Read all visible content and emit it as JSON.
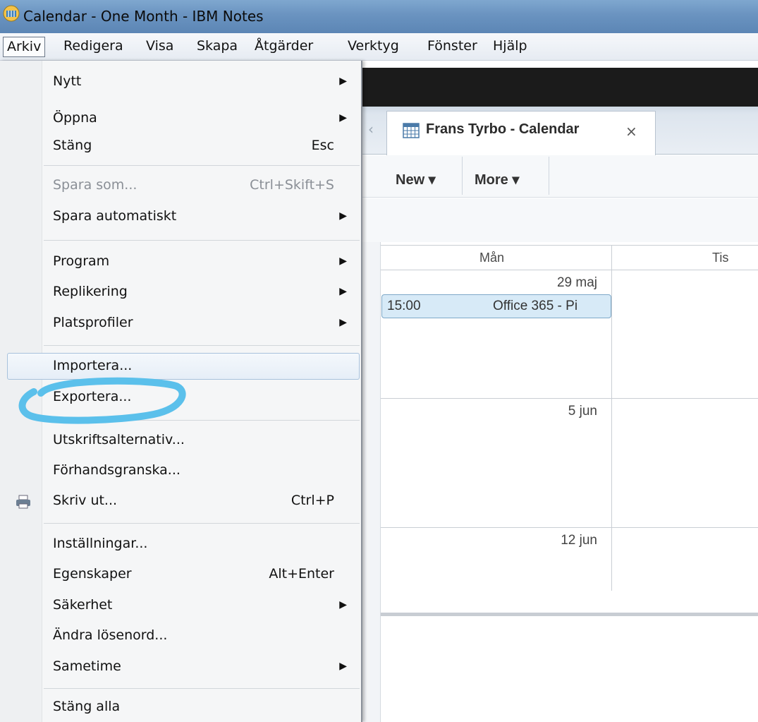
{
  "window": {
    "title": "Calendar - One Month - IBM Notes"
  },
  "menubar": {
    "items": [
      {
        "label": "Arkiv",
        "active": true
      },
      {
        "label": "Redigera"
      },
      {
        "label": "Visa"
      },
      {
        "label": "Skapa"
      },
      {
        "label": "Åtgärder"
      },
      {
        "label": "Verktyg"
      },
      {
        "label": "Fönster"
      },
      {
        "label": "Hjälp"
      }
    ]
  },
  "file_menu": {
    "items": [
      {
        "label": "Nytt",
        "submenu": true
      },
      {
        "label": "Öppna",
        "submenu": true
      },
      {
        "label": "Stäng",
        "shortcut": "Esc"
      },
      {
        "label": "Spara som...",
        "shortcut": "Ctrl+Skift+S",
        "disabled": true
      },
      {
        "label": "Spara automatiskt",
        "submenu": true
      },
      {
        "label": "Program",
        "submenu": true
      },
      {
        "label": "Replikering",
        "submenu": true
      },
      {
        "label": "Platsprofiler",
        "submenu": true
      },
      {
        "label": "Importera...",
        "hovered": true
      },
      {
        "label": "Exportera...",
        "highlighted": true
      },
      {
        "label": "Utskriftsalternativ..."
      },
      {
        "label": "Förhandsgranska..."
      },
      {
        "label": "Skriv ut...",
        "shortcut": "Ctrl+P",
        "icon": "printer-icon"
      },
      {
        "label": "Inställningar..."
      },
      {
        "label": "Egenskaper",
        "shortcut": "Alt+Enter"
      },
      {
        "label": "Säkerhet",
        "submenu": true
      },
      {
        "label": "Ändra lösenord..."
      },
      {
        "label": "Sametime",
        "submenu": true
      },
      {
        "label": "Stäng alla"
      }
    ],
    "submenu_arrow": "▶"
  },
  "tab": {
    "label": "Frans Tyrbo - Calendar",
    "close": "×",
    "scroll_left": "‹",
    "icon": "calendar-icon"
  },
  "actions": {
    "new": "New ▾",
    "more": "More ▾"
  },
  "calendar": {
    "days": [
      "Mån",
      "Tis"
    ],
    "dates": [
      "29 maj",
      "5 jun",
      "12 jun"
    ],
    "event": {
      "time": "15:00",
      "title": "Office 365 - Pi"
    }
  },
  "colors": {
    "title_bar": "#6a93c0",
    "highlight_ring": "#5bc0eb",
    "event_bg": "#d7eaf7"
  }
}
